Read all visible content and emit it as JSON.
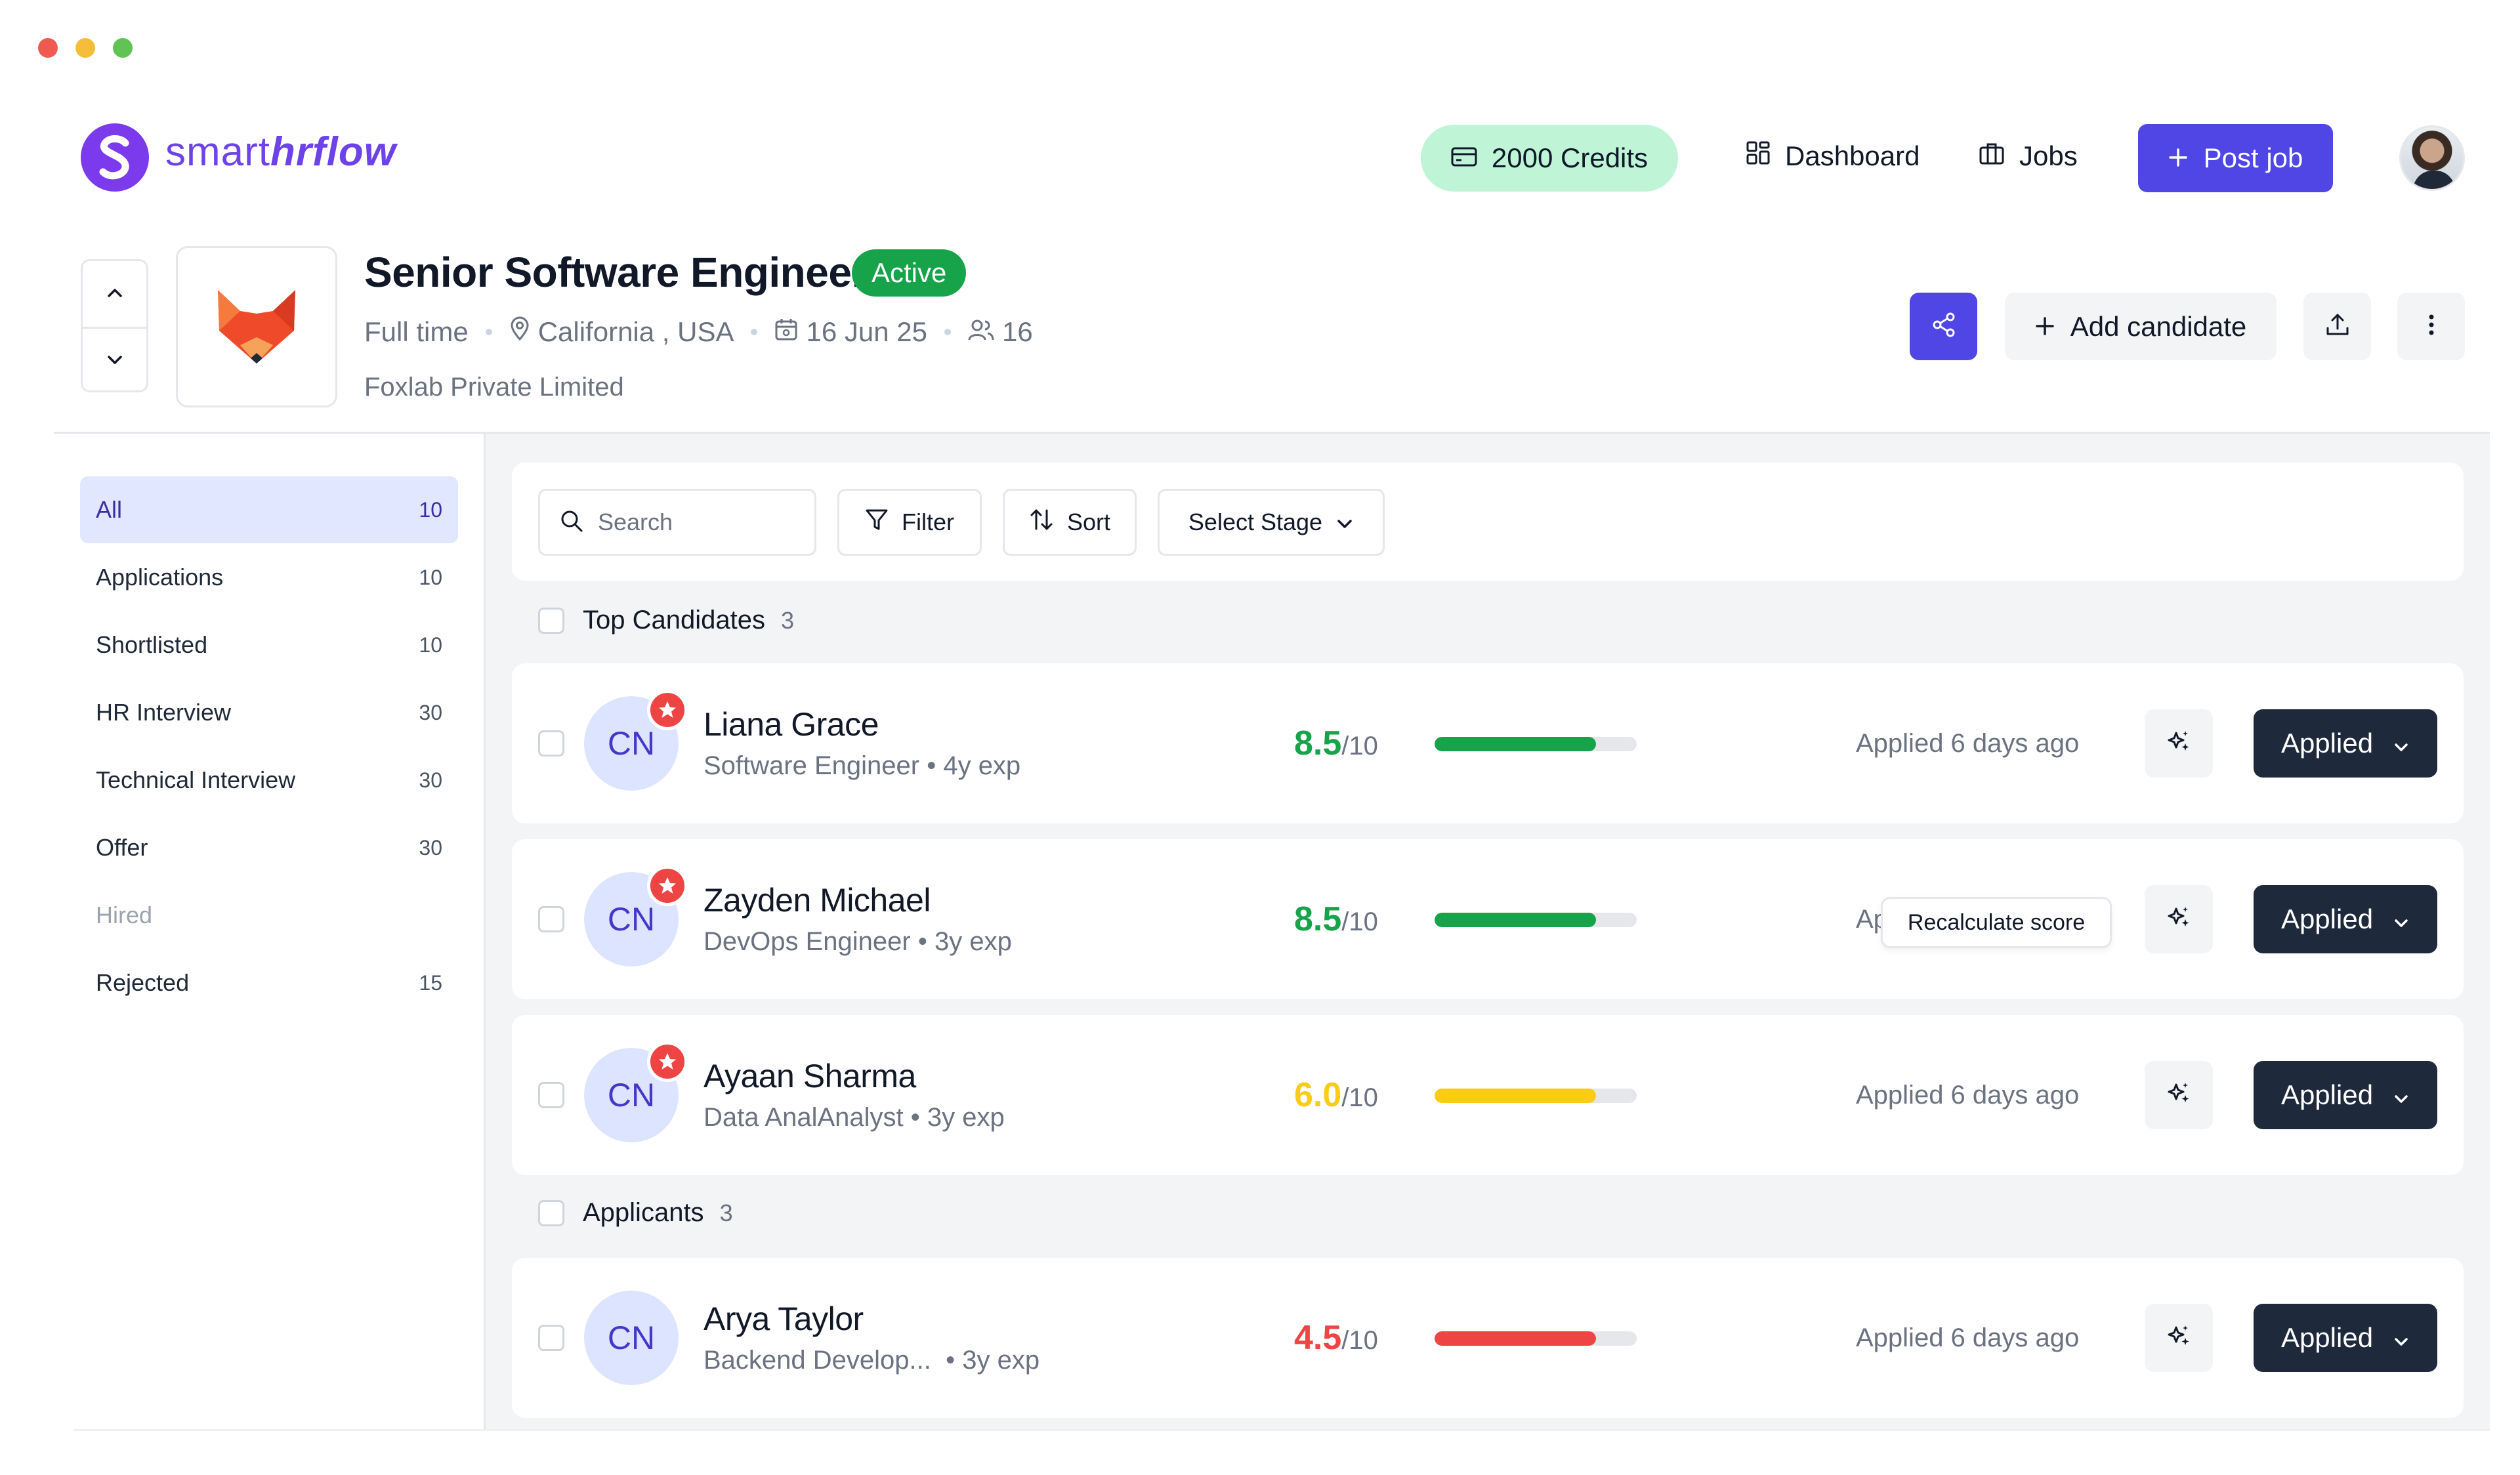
{
  "brand": {
    "name_prefix": "smart",
    "name_suffix": "hrflow"
  },
  "header": {
    "credits_label": "2000 Credits",
    "nav": {
      "dashboard": "Dashboard",
      "jobs": "Jobs"
    },
    "post_job_label": "Post job"
  },
  "job": {
    "title": "Senior Software Engineer",
    "status": "Active",
    "type": "Full time",
    "location": "California , USA",
    "date": "16 Jun 25",
    "openings": "16",
    "company": "Foxlab Private Limited",
    "add_candidate_label": "Add candidate"
  },
  "sidebar": {
    "items": [
      {
        "label": "All",
        "count": "10"
      },
      {
        "label": "Applications",
        "count": "10"
      },
      {
        "label": "Shortlisted",
        "count": "10"
      },
      {
        "label": "HR Interview",
        "count": "30"
      },
      {
        "label": "Technical Interview",
        "count": "30"
      },
      {
        "label": "Offer",
        "count": "30"
      },
      {
        "label": "Hired",
        "count": ""
      },
      {
        "label": "Rejected",
        "count": "15"
      }
    ]
  },
  "toolbar": {
    "search_placeholder": "Search",
    "filter_label": "Filter",
    "sort_label": "Sort",
    "stage_label": "Select Stage"
  },
  "groups": {
    "top": {
      "label": "Top Candidates",
      "count": "3"
    },
    "applicants": {
      "label": "Applicants",
      "count": "3"
    }
  },
  "candidates": [
    {
      "initials": "CN",
      "name": "Liana Grace",
      "role": "Software Engineer",
      "exp": "4y exp",
      "score": "8.5",
      "out_of": "/10",
      "score_fraction": 0.8,
      "score_color": "#16a34a",
      "applied": "Applied 6 days ago",
      "status": "Applied",
      "top": true
    },
    {
      "initials": "CN",
      "name": "Zayden Michael",
      "role": "DevOps Engineer",
      "exp": "3y exp",
      "score": "8.5",
      "out_of": "/10",
      "score_fraction": 0.8,
      "score_color": "#16a34a",
      "applied": "Ap",
      "tooltip": "Recalculate score",
      "status": "Applied",
      "top": true
    },
    {
      "initials": "CN",
      "name": "Ayaan Sharma",
      "role": "Data AnalAnalyst",
      "exp": "3y exp",
      "score": "6.0",
      "out_of": "/10",
      "score_fraction": 0.8,
      "score_color": "#facc15",
      "applied": "Applied 6 days ago",
      "status": "Applied",
      "top": true
    },
    {
      "initials": "CN",
      "name": "Arya Taylor",
      "role": "Backend Develop...",
      "exp": "3y exp",
      "score": "4.5",
      "out_of": "/10",
      "score_fraction": 0.8,
      "score_color": "#ef4444",
      "applied": "Applied 6 days ago",
      "status": "Applied",
      "top": false
    }
  ],
  "colors": {
    "accent": "#4f46e5",
    "active": "#16a34a",
    "dark_button": "#1e293b"
  }
}
